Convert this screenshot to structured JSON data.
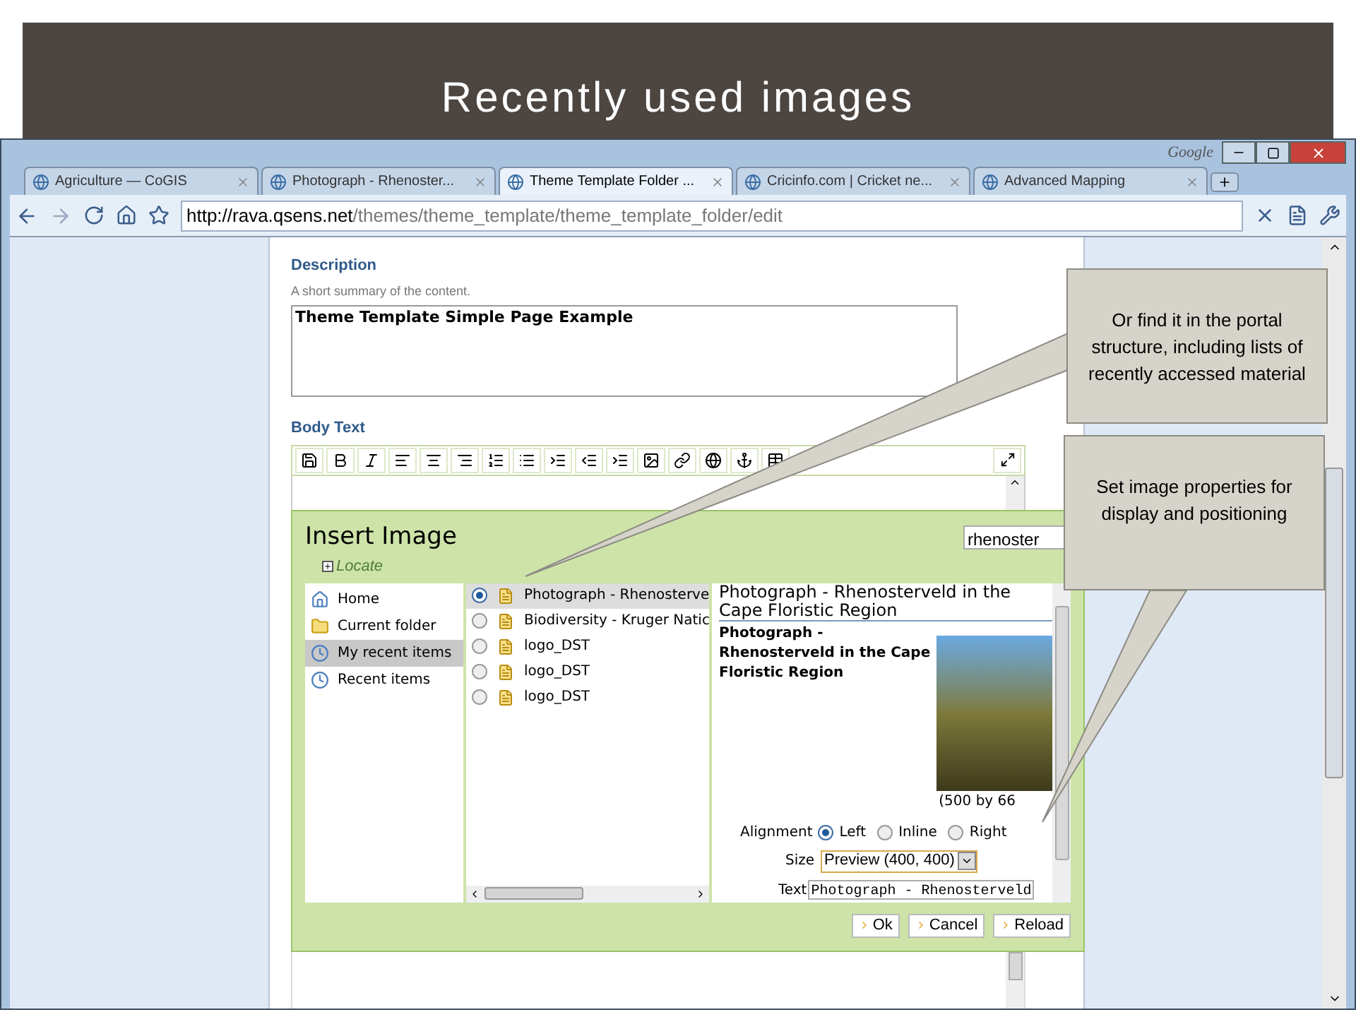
{
  "slide": {
    "title": "Recently used images"
  },
  "browser": {
    "brand": "Google",
    "tabs": [
      {
        "label": "Agriculture — CoGIS",
        "selected": false
      },
      {
        "label": "Photograph - Rhenoster...",
        "selected": false
      },
      {
        "label": "Theme Template Folder ...",
        "selected": true
      },
      {
        "label": "Cricinfo.com | Cricket ne...",
        "selected": false
      },
      {
        "label": "Advanced Mapping",
        "selected": false
      }
    ],
    "address": {
      "host": "http://rava.qsens.net",
      "path": "/themes/theme_template/theme_template_folder/edit"
    }
  },
  "form": {
    "description": {
      "label": "Description",
      "help": "A short summary of the content.",
      "value": "Theme Template Simple Page Example"
    },
    "body_text": {
      "label": "Body Text"
    }
  },
  "dialog": {
    "title": "Insert Image",
    "locate": "Locate",
    "search": "rhenoster",
    "nav": [
      {
        "label": "Home",
        "kind": "home",
        "selected": false
      },
      {
        "label": "Current folder",
        "kind": "folder",
        "selected": false
      },
      {
        "label": "My recent items",
        "kind": "recent",
        "selected": true
      },
      {
        "label": "Recent items",
        "kind": "recent",
        "selected": false
      }
    ],
    "items": [
      {
        "label": "Photograph - Rhenosterve",
        "selected": true
      },
      {
        "label": "Biodiversity - Kruger Natic",
        "selected": false
      },
      {
        "label": "logo_DST",
        "selected": false
      },
      {
        "label": "logo_DST",
        "selected": false
      },
      {
        "label": "logo_DST",
        "selected": false
      }
    ],
    "preview": {
      "title": "Photograph - Rhenosterveld in the Cape Floristic Region",
      "caption": "Photograph - Rhenosterveld in the Cape Floristic Region",
      "dimensions": "(500 by 66",
      "alignment_label": "Alignment",
      "alignments": [
        {
          "label": "Left",
          "selected": true
        },
        {
          "label": "Inline",
          "selected": false
        },
        {
          "label": "Right",
          "selected": false
        }
      ],
      "size_label": "Size",
      "size": "Preview (400, 400)",
      "text_label": "Text",
      "text": "Photograph - Rhenosterveld"
    },
    "buttons": [
      "Ok",
      "Cancel",
      "Reload"
    ]
  },
  "callouts": [
    "Or find it in the portal structure, including lists of recently  accessed material",
    "Set image properties for display and positioning"
  ]
}
